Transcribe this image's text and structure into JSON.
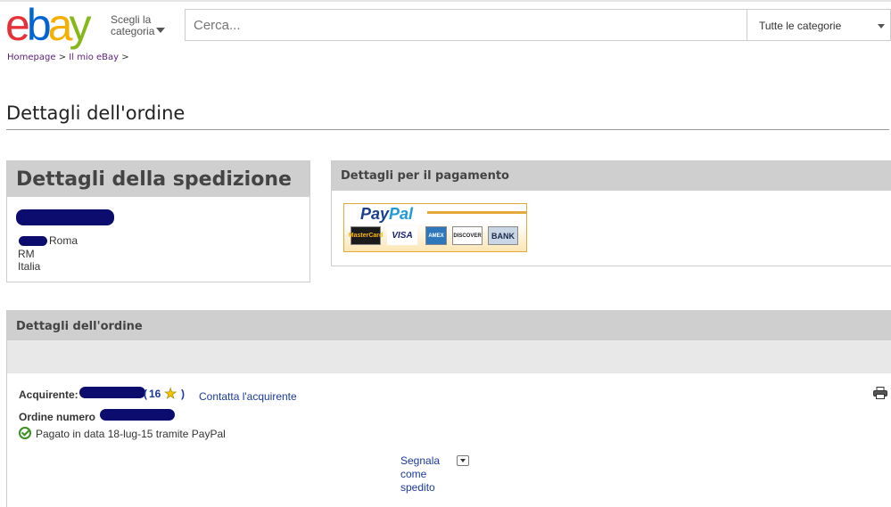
{
  "header": {
    "logo_letters": [
      "e",
      "b",
      "a",
      "y"
    ],
    "logo_colors": [
      "#e53238",
      "#0064d2",
      "#f5af02",
      "#86b817"
    ],
    "category_button": [
      "Scegli la",
      "categoria"
    ],
    "search_placeholder": "Cerca...",
    "category_select": "Tutte le categorie"
  },
  "breadcrumb": {
    "items": [
      "Homepage",
      "Il mio eBay"
    ],
    "separator": ">"
  },
  "page_title": "Dettagli dell'ordine",
  "shipping": {
    "title": "Dettagli della spedizione",
    "city": "Roma",
    "province": "RM",
    "country": "Italia"
  },
  "payment": {
    "title": "Dettagli per il pagamento",
    "logo_pay": "Pay",
    "logo_pal": "Pal",
    "cards": [
      "MasterCard",
      "VISA",
      "AMEX",
      "DISCOVER",
      "BANK"
    ]
  },
  "order": {
    "title": "Dettagli dell'ordine",
    "buyer_label": "Acquirente:",
    "feedback_open": "(",
    "feedback_score": "16",
    "feedback_close": ")",
    "contact_link": "Contatta l'acquirente",
    "order_number_label": "Ordine numero",
    "paid_status": "Pagato in data 18-lug-15 tramite PayPal",
    "mark_shipped": [
      "Segnala",
      "come",
      "spedito"
    ]
  },
  "icons": {
    "star": "feedback-star-icon",
    "check": "paid-check-icon",
    "printer": "printer-icon"
  }
}
